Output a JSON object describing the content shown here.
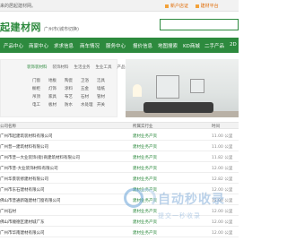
{
  "topbar": {
    "welcome": "来的居起建材网。",
    "links": [
      "新户店证",
      "建材平台"
    ]
  },
  "header": {
    "logo": "起建材网",
    "city": "广州市(城市切换)",
    "search_placeholder": ""
  },
  "nav": [
    "产品中心",
    "商家中心",
    "求求信息",
    "商车情况",
    "服务中心",
    "报价信息",
    "地图搜索",
    "KD商城",
    "二手产品",
    "2D"
  ],
  "sidebar": {
    "tabs": [
      "装饰装材料",
      "装饰材料",
      "生活业务",
      "生业工具",
      "产品分享"
    ],
    "categories": [
      "门窗",
      "地板",
      "陶瓷",
      "卫浴",
      "洁具",
      "橱柜",
      "灯饰",
      "涂料",
      "五金",
      "墙纸",
      "吊顶",
      "家具",
      "布艺",
      "石材",
      "管材",
      "电工",
      "板材",
      "防水",
      "水处理",
      "开关"
    ]
  },
  "table": {
    "headers": [
      "公司名称",
      "所属实行业",
      "时间"
    ],
    "rows": [
      {
        "name": "广州市起建筑装材料有限公司",
        "category": "建材业务产资",
        "time": "11.00 公里"
      },
      {
        "name": "广州普一建筑材料有限公司",
        "category": "建材业务产资",
        "time": "11.00 公里"
      },
      {
        "name": "广州市普一大业装饰(街)商建筑材料有限公司",
        "category": "建材业务产资",
        "time": "11.82 公里"
      },
      {
        "name": "广州市普-大业装饰材料有限公司",
        "category": "建材业务产资",
        "time": "12.00 公里"
      },
      {
        "name": "广州华景装修建材有限公司",
        "category": "建材业务产资",
        "time": "12.82 公里"
      },
      {
        "name": "广州市东石建材有限公司",
        "category": "建材业务产资",
        "time": "12.00 公里"
      },
      {
        "name": "佛山市普通新雄建材门窗有限公司",
        "category": "建材业务产资",
        "time": "12.00 公里"
      },
      {
        "name": "广州石材",
        "category": "建材业务产资",
        "time": "12.00 公里"
      },
      {
        "name": "佛山市顺德区建材城广东",
        "category": "建材业务产资",
        "time": "12.00 公里"
      },
      {
        "name": "广州市华南建材有限公司",
        "category": "建材业务产资",
        "time": "12.00 公里"
      },
      {
        "name": "佛山市顺德区新材料装修门窗厂",
        "category": "建材业务产资",
        "time": "12.00 公里"
      },
      {
        "name": "佛山市顺德区建材城广东门窗厂",
        "category": "建材业务产资",
        "time": "12.00 公里"
      },
      {
        "name": "广州市卫浴建材装修有限公司",
        "category": "建材业务产资",
        "time": "12.00 公里"
      },
      {
        "name": "广州石材,新材料门业厂",
        "category": "建材业务产资",
        "time": "12.00 公里"
      },
      {
        "name": "广州市建材门窗有限公司",
        "category": "建材业务产资",
        "time": "12.00 公里"
      },
      {
        "name": "广州市新型五金材料城市门窗",
        "category": "建材业务产资",
        "time": "12.00 公里"
      },
      {
        "name": "广州家居装修材料门店",
        "category": "建材业务产资",
        "time": "12.00 公里"
      }
    ]
  },
  "watermark": {
    "main": "自动秒收录",
    "sub": "提交一秒收录"
  },
  "colors": {
    "brand": "#2d8a3e",
    "accent": "#e06a00"
  }
}
